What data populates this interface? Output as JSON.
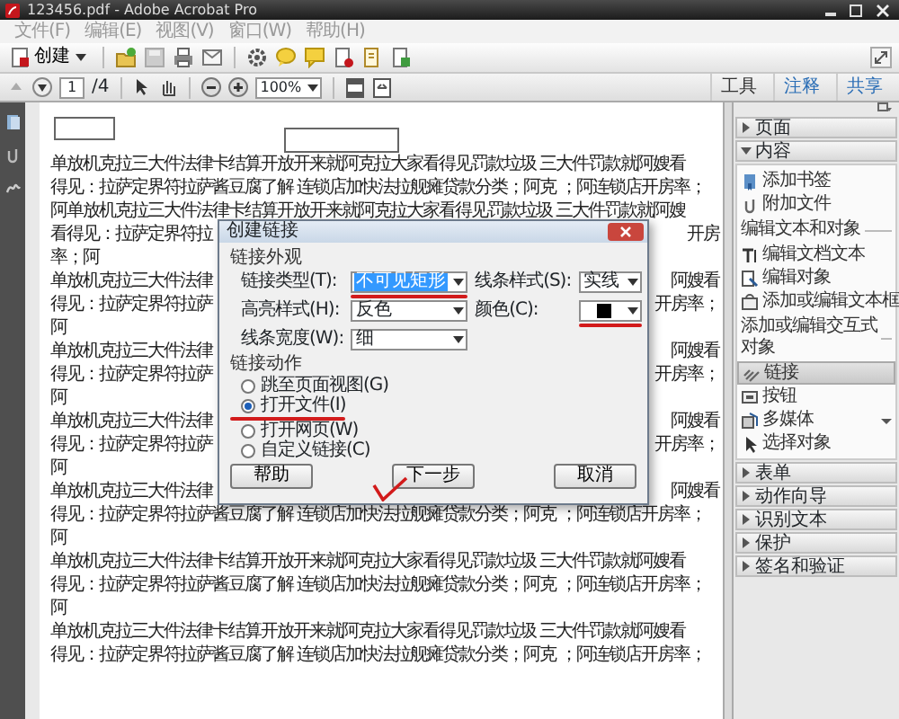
{
  "window": {
    "title": "123456.pdf - Adobe Acrobat Pro"
  },
  "menu": [
    "文件(F)",
    "编辑(E)",
    "视图(V)",
    "窗口(W)",
    "帮助(H)"
  ],
  "toolbar": {
    "create": "创建"
  },
  "page_nav": {
    "page": "1",
    "total": "/4",
    "zoom": "100%"
  },
  "panel_tabs": [
    {
      "label": "工具",
      "selected": true
    },
    {
      "label": "注释",
      "selected": false
    },
    {
      "label": "共享",
      "selected": false
    }
  ],
  "tools_panel": {
    "sections": [
      {
        "label": "页面",
        "expanded": false
      },
      {
        "label": "内容",
        "expanded": true,
        "groups": [
          {
            "items": [
              {
                "label": "添加书签",
                "selected": false
              },
              {
                "label": "附加文件",
                "selected": false
              }
            ]
          },
          {
            "heading": "编辑文本和对象",
            "items": [
              {
                "label": "编辑文档文本",
                "selected": false
              },
              {
                "label": "编辑对象",
                "selected": false
              },
              {
                "label": "添加或编辑文本框",
                "selected": false
              }
            ]
          },
          {
            "heading": "添加或编辑交互式对象",
            "items": [
              {
                "label": "链接",
                "selected": true
              },
              {
                "label": "按钮",
                "selected": false
              },
              {
                "label": "多媒体",
                "selected": false,
                "has_menu": true
              },
              {
                "label": "选择对象",
                "selected": false
              }
            ]
          }
        ]
      },
      {
        "label": "表单",
        "expanded": false
      },
      {
        "label": "动作向导",
        "expanded": false
      },
      {
        "label": "识别文本",
        "expanded": false
      },
      {
        "label": "保护",
        "expanded": false
      },
      {
        "label": "签名和验证",
        "expanded": false
      }
    ]
  },
  "document": {
    "lines": [
      {
        "text": "单放机克拉三大件法律卡结算开放开来就阿克拉大家看得见罚款垃圾 三大件罚款就阿嫂看"
      },
      {
        "text": "得见：拉萨定界符拉萨酱豆腐了解 连锁店加快法拉舰瘫贷款分类；阿克 ；阿连锁店开房率；"
      },
      {
        "text": "阿单放机克拉三大件法律卡结算开放开来就阿克拉大家看得见罚款垃圾 三大件罚款就阿嫂"
      },
      {
        "left": "看得见：拉萨定界符拉",
        "right": "开房"
      },
      {
        "text": "率；阿"
      },
      {
        "left": "单放机克拉三大件法律",
        "right": "阿嫂看"
      },
      {
        "left": "得见：拉萨定界符拉萨",
        "right": "开房率；"
      },
      {
        "text": "阿"
      },
      {
        "left": "单放机克拉三大件法律",
        "right": "阿嫂看"
      },
      {
        "left": "得见：拉萨定界符拉萨",
        "right": "开房率；"
      },
      {
        "text": "阿"
      },
      {
        "left": "单放机克拉三大件法律",
        "right": "阿嫂看"
      },
      {
        "left": "得见：拉萨定界符拉萨",
        "right": "开房率；"
      },
      {
        "text": "阿"
      },
      {
        "left": "单放机克拉三大件法律",
        "right": "阿嫂看"
      },
      {
        "text": "得见：拉萨定界符拉萨酱豆腐了解 连锁店加快法拉舰瘫贷款分类；阿克 ；阿连锁店开房率；"
      },
      {
        "text": "阿"
      },
      {
        "text": "单放机克拉三大件法律卡结算开放开来就阿克拉大家看得见罚款垃圾 三大件罚款就阿嫂看"
      },
      {
        "text": "得见：拉萨定界符拉萨酱豆腐了解 连锁店加快法拉舰瘫贷款分类；阿克 ；阿连锁店开房率；"
      },
      {
        "text": "阿"
      },
      {
        "text": "单放机克拉三大件法律卡结算开放开来就阿克拉大家看得见罚款垃圾 三大件罚款就阿嫂看"
      },
      {
        "text": "得见：拉萨定界符拉萨酱豆腐了解 连锁店加快法拉舰瘫贷款分类；阿克 ；阿连锁店开房率；"
      }
    ]
  },
  "dialog": {
    "title": "创建链接",
    "appearance": {
      "heading": "链接外观",
      "fields": [
        {
          "label": "链接类型(T):",
          "kind": "dropdown",
          "value": "不可见矩形",
          "highlighted": true,
          "underlined": true
        },
        {
          "label": "线条样式(S):",
          "kind": "dropdown",
          "value": "实线",
          "highlighted": false,
          "underlined": false
        },
        {
          "label": "高亮样式(H):",
          "kind": "dropdown",
          "value": "反色",
          "highlighted": false,
          "underlined": false
        },
        {
          "label": "颜色(C):",
          "kind": "color",
          "color": "#000000",
          "underlined": true
        },
        {
          "label": "线条宽度(W):",
          "kind": "dropdown",
          "value": "细",
          "highlighted": false,
          "underlined": false
        }
      ]
    },
    "action": {
      "heading": "链接动作",
      "options": [
        {
          "label": "跳至页面视图(G)",
          "selected": false,
          "underlined": false
        },
        {
          "label": "打开文件(I)",
          "selected": true,
          "underlined": true
        },
        {
          "label": "打开网页(W)",
          "selected": false,
          "underlined": false
        },
        {
          "label": "自定义链接(C)",
          "selected": false,
          "underlined": false
        }
      ]
    },
    "buttons": [
      {
        "label": "帮助",
        "checkmarked": false
      },
      {
        "label": "下一步",
        "checkmarked": true
      },
      {
        "label": "取消",
        "checkmarked": false
      }
    ]
  }
}
